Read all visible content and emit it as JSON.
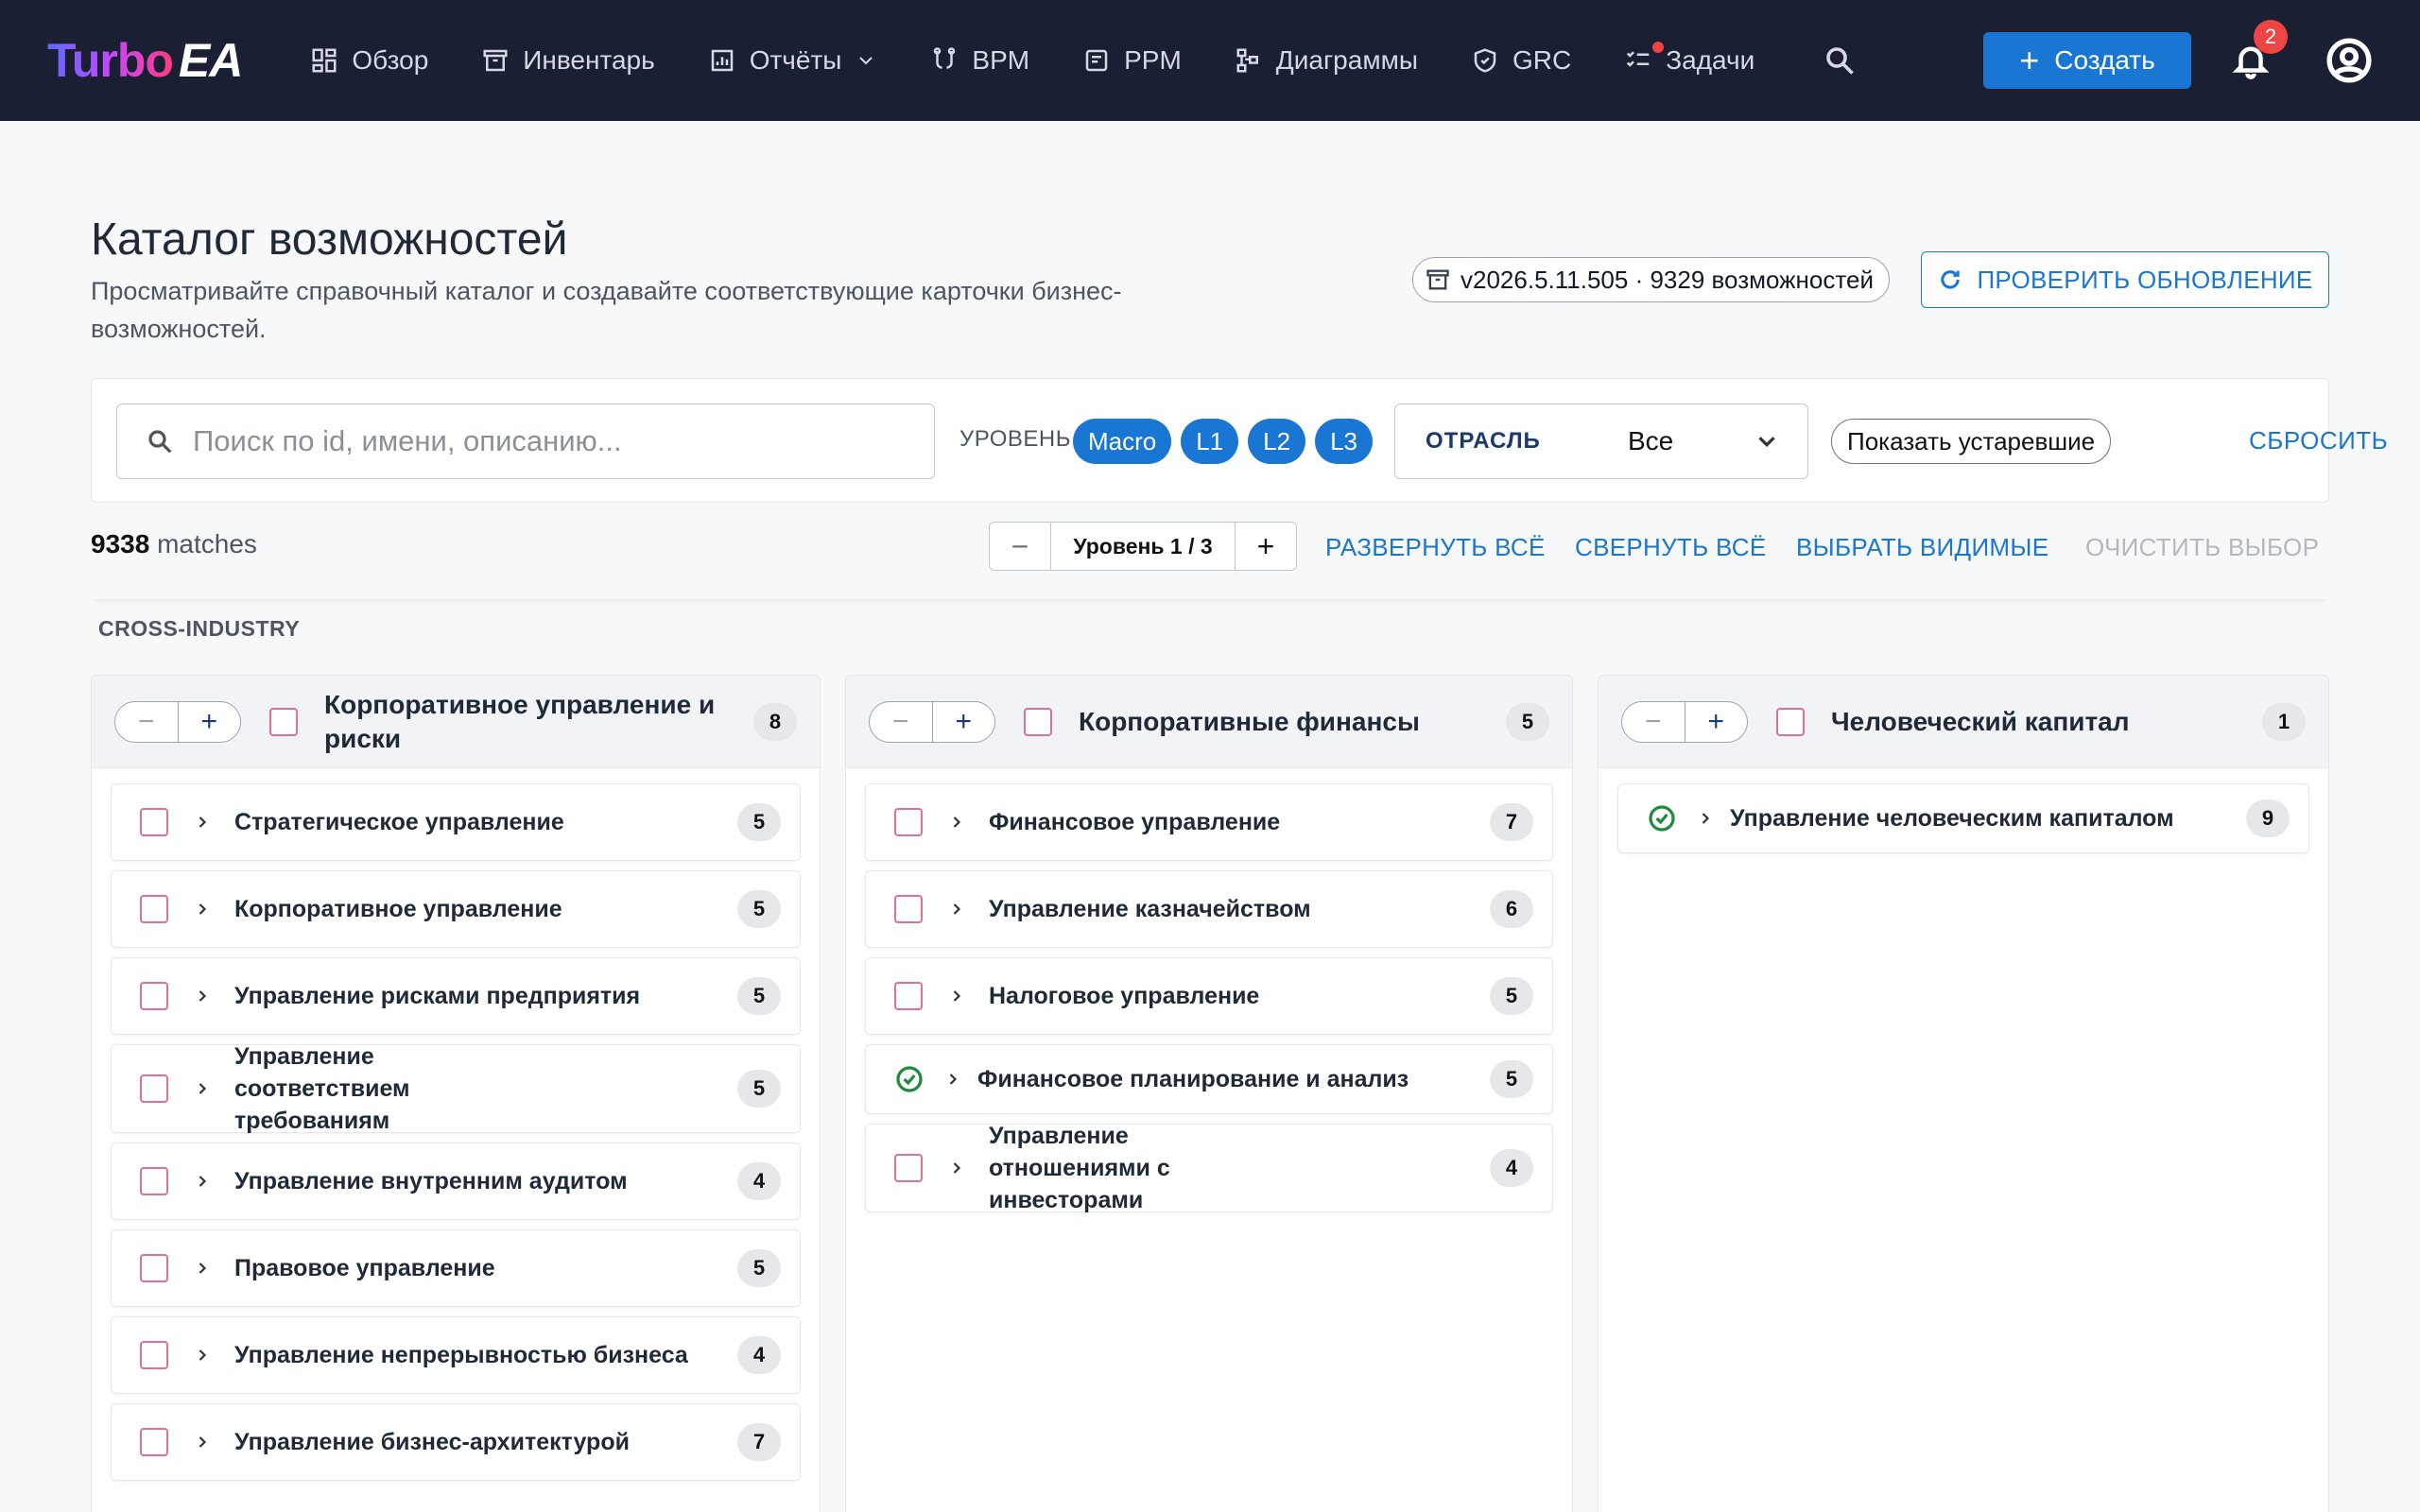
{
  "app": {
    "logo_primary": "Turbo",
    "logo_secondary": "EA"
  },
  "nav": {
    "items": [
      {
        "label": "Обзор",
        "icon": "dashboard-icon"
      },
      {
        "label": "Инвентарь",
        "icon": "archive-icon"
      },
      {
        "label": "Отчёты",
        "icon": "report-icon"
      },
      {
        "label": "BPM",
        "icon": "flow-icon"
      },
      {
        "label": "PPM",
        "icon": "project-icon"
      },
      {
        "label": "Диаграммы",
        "icon": "diagram-icon"
      },
      {
        "label": "GRC",
        "icon": "shield-icon"
      },
      {
        "label": "Задачи",
        "icon": "tasks-icon"
      }
    ],
    "create_label": "Создать",
    "notifications_count": "2"
  },
  "header": {
    "title": "Каталог возможностей",
    "subtitle": "Просматривайте справочный каталог и создавайте соответствующие карточки бизнес-возможностей.",
    "version": "v2026.5.11.505 · 9329 возможностей",
    "check_update": "ПРОВЕРИТЬ ОБНОВЛЕНИЕ"
  },
  "filters": {
    "search_placeholder": "Поиск по id, имени, описанию...",
    "level_label": "УРОВЕНЬ",
    "levels": [
      "Macro",
      "L1",
      "L2",
      "L3"
    ],
    "industry_label": "ОТРАСЛЬ",
    "industry_value": "Все",
    "show_deprecated": "Показать устаревшие",
    "reset": "СБРОСИТЬ"
  },
  "toolbar": {
    "matches_count": "9338",
    "matches_suffix": " matches",
    "level_stepper": "Уровень 1 / 3",
    "expand_all": "РАЗВЕРНУТЬ ВСЁ",
    "collapse_all": "СВЕРНУТЬ ВСЁ",
    "select_visible": "ВЫБРАТЬ ВИДИМЫЕ",
    "clear_selection": "ОЧИСТИТЬ ВЫБОР"
  },
  "section": "CROSS-INDUSTRY",
  "columns": [
    {
      "title": "Корпоративное управление и риски",
      "count": "8",
      "rows": [
        {
          "title": "Стратегическое управление",
          "count": "5",
          "done": false
        },
        {
          "title": "Корпоративное управление",
          "count": "5",
          "done": false
        },
        {
          "title": "Управление рисками предприятия",
          "count": "5",
          "done": false
        },
        {
          "title": "Управление соответствием требованиям",
          "count": "5",
          "done": false
        },
        {
          "title": "Управление внутренним аудитом",
          "count": "4",
          "done": false
        },
        {
          "title": "Правовое управление",
          "count": "5",
          "done": false
        },
        {
          "title": "Управление непрерывностью бизнеса",
          "count": "4",
          "done": false
        },
        {
          "title": "Управление бизнес-архитектурой",
          "count": "7",
          "done": false
        }
      ]
    },
    {
      "title": "Корпоративные финансы",
      "count": "5",
      "rows": [
        {
          "title": "Финансовое управление",
          "count": "7",
          "done": false
        },
        {
          "title": "Управление казначейством",
          "count": "6",
          "done": false
        },
        {
          "title": "Налоговое управление",
          "count": "5",
          "done": false
        },
        {
          "title": "Финансовое планирование и анализ",
          "count": "5",
          "done": true
        },
        {
          "title": "Управление отношениями с инвесторами",
          "count": "4",
          "done": false
        }
      ]
    },
    {
      "title": "Человеческий капитал",
      "count": "1",
      "rows": [
        {
          "title": "Управление человеческим капиталом",
          "count": "9",
          "done": true
        }
      ]
    }
  ]
}
